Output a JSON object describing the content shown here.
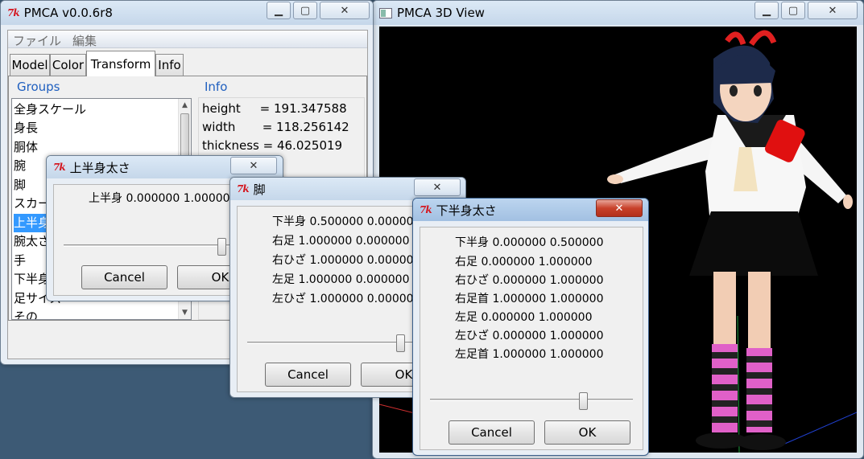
{
  "main_window": {
    "title": "PMCA v0.0.6r8",
    "menu": [
      "ファイル",
      "編集"
    ],
    "tabs": [
      "Model",
      "Color",
      "Transform",
      "Info"
    ],
    "active_tab": "Transform",
    "groups_label": "Groups",
    "info_label": "Info",
    "groups": [
      "全身スケール",
      "身長",
      "胴体",
      "腕",
      "脚",
      "スカート",
      "上半身",
      "腕太さ",
      "手",
      "下半身",
      "足サイズ",
      "その"
    ],
    "selected_group": "上半身",
    "info": {
      "height": "height     = 191.347588",
      "width": "width       = 118.256142",
      "thickness": "thickness = 46.025019"
    }
  },
  "view3d": {
    "title": "PMCA 3D View"
  },
  "dialog_upper": {
    "title": "上半身太さ",
    "lines": [
      "上半身 0.000000 1.000000"
    ],
    "slider_value": 0.5,
    "cancel": "Cancel",
    "ok": "OK"
  },
  "dialog_leg": {
    "title": "脚",
    "lines": [
      "下半身 0.500000 0.000000",
      "右足 1.000000 0.000000",
      "右ひざ 1.000000 0.000000",
      "左足 1.000000 0.000000",
      "左ひざ 1.000000 0.000000"
    ],
    "slider_value": 0.5,
    "cancel": "Cancel",
    "ok": "OK"
  },
  "dialog_lower": {
    "title": "下半身太さ",
    "lines": [
      "下半身 0.000000 0.500000",
      "右足 0.000000 1.000000",
      "右ひざ 0.000000 1.000000",
      "右足首 1.000000 1.000000",
      "左足 0.000000 1.000000",
      "左ひざ 0.000000 1.000000",
      "左足首 1.000000 1.000000"
    ],
    "slider_value": 0.5,
    "cancel": "Cancel",
    "ok": "OK"
  },
  "icons": {
    "minimize": "minimize-icon",
    "maximize": "maximize-icon",
    "close": "close-icon",
    "app": "tk-feather-icon"
  },
  "colors": {
    "accent_blue": "#3399ff",
    "title_red": "#c8412a",
    "label_blue": "#1f5fbf"
  }
}
